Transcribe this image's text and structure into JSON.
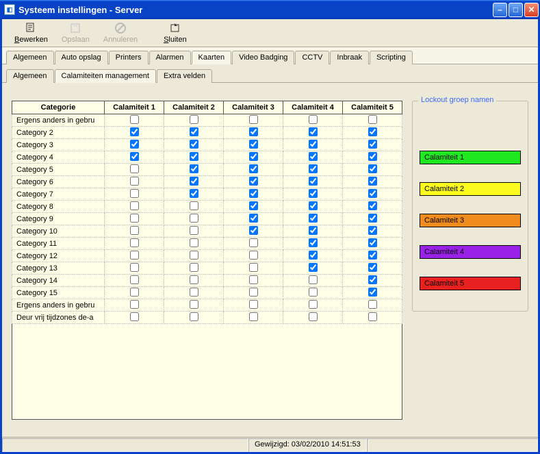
{
  "window": {
    "title": "Systeem instellingen - Server"
  },
  "toolbar": {
    "edit": {
      "label": "Bewerken",
      "key": "B",
      "enabled": true
    },
    "save": {
      "label": "Opslaan",
      "key": "O",
      "enabled": false
    },
    "cancel": {
      "label": "Annuleren",
      "key": "A",
      "enabled": false
    },
    "close": {
      "label": "Sluiten",
      "key": "S",
      "enabled": true
    }
  },
  "tabs_primary": [
    "Algemeen",
    "Auto opslag",
    "Printers",
    "Alarmen",
    "Kaarten",
    "Video Badging",
    "CCTV",
    "Inbraak",
    "Scripting"
  ],
  "tabs_primary_active": 4,
  "tabs_secondary": [
    "Algemeen",
    "Calamiteiten management",
    "Extra velden"
  ],
  "tabs_secondary_active": 1,
  "table": {
    "headers": [
      "Categorie",
      "Calamiteit 1",
      "Calamiteit 2",
      "Calamiteit 3",
      "Calamiteit 4",
      "Calamiteit 5"
    ],
    "rows": [
      {
        "cat": "Ergens anders in gebru",
        "c": [
          false,
          false,
          false,
          false,
          false
        ]
      },
      {
        "cat": "Category 2",
        "c": [
          true,
          true,
          true,
          true,
          true
        ]
      },
      {
        "cat": "Category 3",
        "c": [
          true,
          true,
          true,
          true,
          true
        ]
      },
      {
        "cat": "Category 4",
        "c": [
          true,
          true,
          true,
          true,
          true
        ]
      },
      {
        "cat": "Category 5",
        "c": [
          false,
          true,
          true,
          true,
          true
        ]
      },
      {
        "cat": "Category 6",
        "c": [
          false,
          true,
          true,
          true,
          true
        ]
      },
      {
        "cat": "Category 7",
        "c": [
          false,
          true,
          true,
          true,
          true
        ]
      },
      {
        "cat": "Category 8",
        "c": [
          false,
          false,
          true,
          true,
          true
        ]
      },
      {
        "cat": "Category 9",
        "c": [
          false,
          false,
          true,
          true,
          true
        ]
      },
      {
        "cat": "Category 10",
        "c": [
          false,
          false,
          true,
          true,
          true
        ]
      },
      {
        "cat": "Category 11",
        "c": [
          false,
          false,
          false,
          true,
          true
        ]
      },
      {
        "cat": "Category 12",
        "c": [
          false,
          false,
          false,
          true,
          true
        ]
      },
      {
        "cat": "Category 13",
        "c": [
          false,
          false,
          false,
          true,
          true
        ]
      },
      {
        "cat": "Category 14",
        "c": [
          false,
          false,
          false,
          false,
          true
        ]
      },
      {
        "cat": "Category 15",
        "c": [
          false,
          false,
          false,
          false,
          true
        ]
      },
      {
        "cat": "Ergens anders in gebru",
        "c": [
          false,
          false,
          false,
          false,
          false
        ]
      },
      {
        "cat": "Deur vrij tijdzones de-a",
        "c": [
          false,
          false,
          false,
          false,
          false
        ]
      }
    ]
  },
  "lockout": {
    "title": "Lockout groep namen",
    "items": [
      {
        "label": "Calamiteit 1",
        "color": "#20e820"
      },
      {
        "label": "Calamiteit 2",
        "color": "#fbfb20"
      },
      {
        "label": "Calamiteit 3",
        "color": "#f08b1d"
      },
      {
        "label": "Calamiteit 4",
        "color": "#9a22e8"
      },
      {
        "label": "Calamiteit 5",
        "color": "#e82020"
      }
    ]
  },
  "status": {
    "modified": "Gewijzigd: 03/02/2010 14:51:53"
  }
}
